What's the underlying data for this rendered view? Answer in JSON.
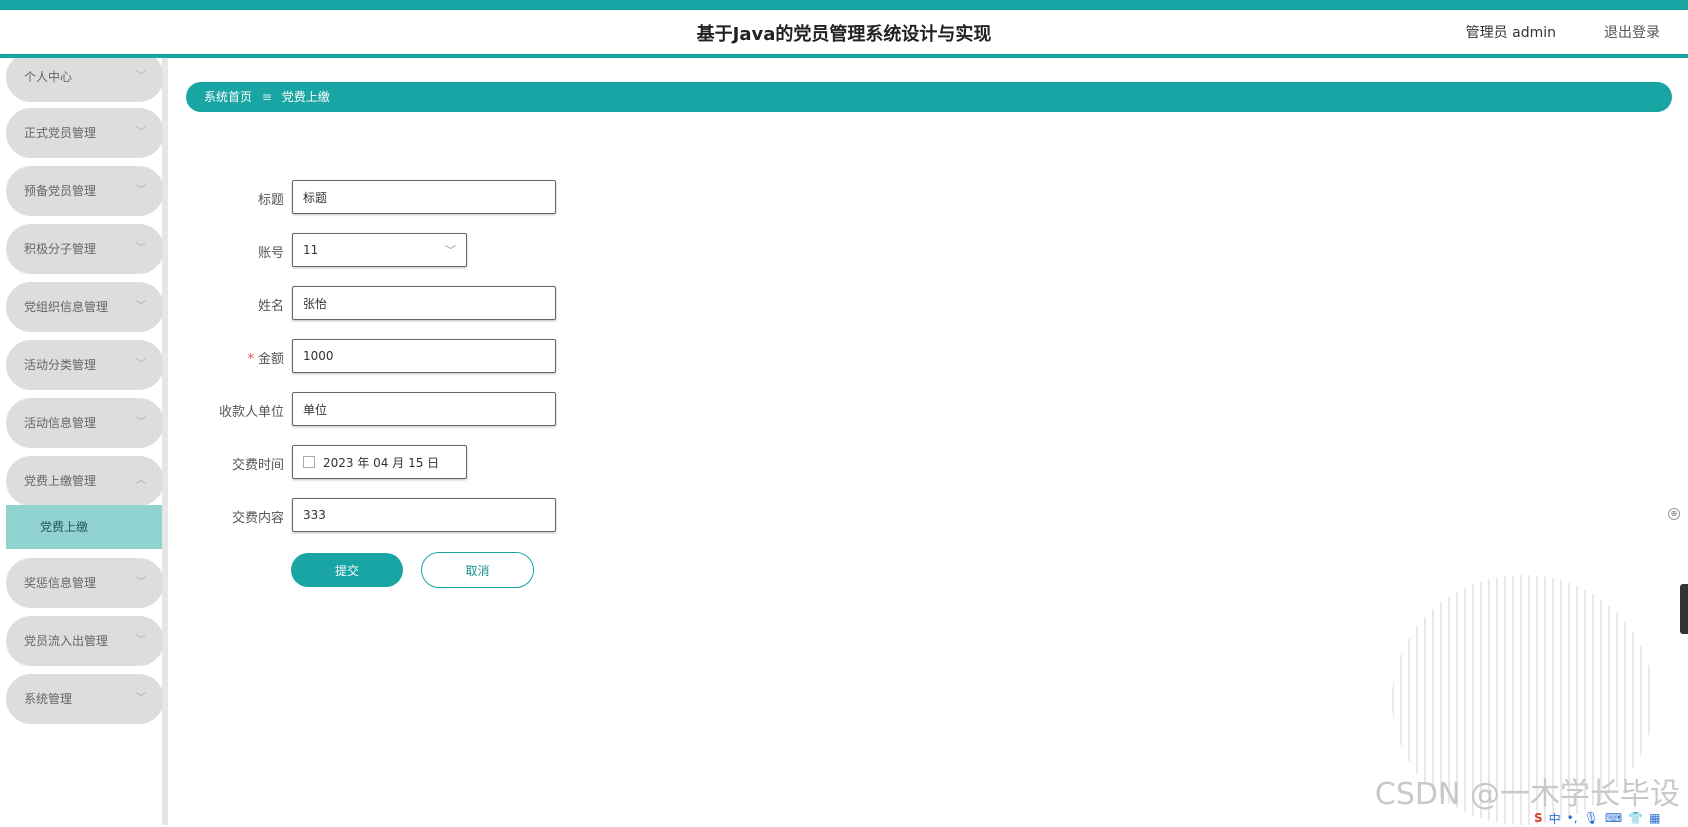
{
  "header": {
    "title": "基于Java的党员管理系统设计与实现",
    "user": "管理员 admin",
    "logout": "退出登录"
  },
  "sidebar": {
    "items": [
      {
        "label": "个人中心"
      },
      {
        "label": "正式党员管理"
      },
      {
        "label": "预备党员管理"
      },
      {
        "label": "积极分子管理"
      },
      {
        "label": "党组织信息管理"
      },
      {
        "label": "活动分类管理"
      },
      {
        "label": "活动信息管理"
      },
      {
        "label": "党费上缴管理",
        "expanded": true,
        "children": [
          {
            "label": "党费上缴",
            "active": true
          }
        ]
      },
      {
        "label": "奖惩信息管理"
      },
      {
        "label": "党员流入出管理"
      },
      {
        "label": "系统管理"
      }
    ]
  },
  "breadcrumb": {
    "home": "系统首页",
    "separator": "≡",
    "current": "党费上缴"
  },
  "form": {
    "title": {
      "label": "标题",
      "value": "标题"
    },
    "account": {
      "label": "账号",
      "value": "11"
    },
    "name": {
      "label": "姓名",
      "value": "张怡"
    },
    "amount": {
      "label": "金额",
      "required_mark": "*",
      "value": "1000"
    },
    "payee_unit": {
      "label": "收款人单位",
      "value": "单位"
    },
    "pay_time": {
      "label": "交费时间",
      "value": "2023 年 04 月 15 日"
    },
    "pay_content": {
      "label": "交费内容",
      "value": "333"
    }
  },
  "actions": {
    "submit": "提交",
    "cancel": "取消"
  },
  "overlay": {
    "watermark": "CSDN @一木学长毕设",
    "ime_label": "中"
  },
  "colors": {
    "accent": "#1aa5a5",
    "menu_bg": "#dddddd",
    "submenu_active_bg": "#91d3d0"
  }
}
